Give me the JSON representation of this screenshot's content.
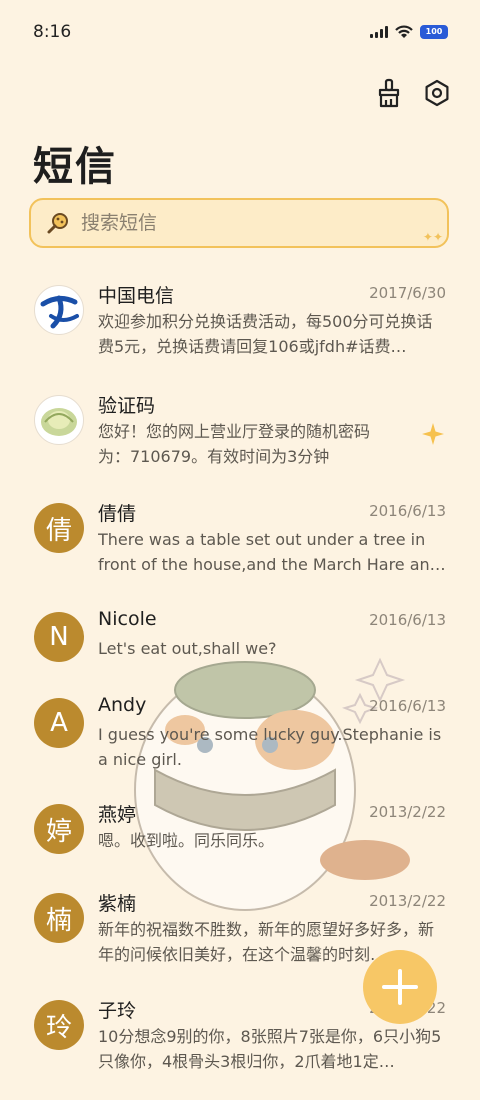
{
  "status": {
    "time": "8:16",
    "battery": "100"
  },
  "page": {
    "title": "短信"
  },
  "search": {
    "placeholder": "搜索短信"
  },
  "messages": [
    {
      "name": "中国电信",
      "date": "2017/6/30",
      "preview": "欢迎参加积分兑换话费活动，每500分可兑换话费5元，兑换话费请回复106或jfdh#话费…",
      "avatar": "china-telecom-logo"
    },
    {
      "name": "验证码",
      "date": "",
      "preview": "您好！您的网上营业厅登录的随机密码为：710679。有效时间为3分钟",
      "avatar": "cabbage-image",
      "starred": true
    },
    {
      "name": "倩倩",
      "date": "2016/6/13",
      "preview": "There was a table set out under a tree in front of the house,and the March Hare an…",
      "avatar_text": "倩"
    },
    {
      "name": "Nicole",
      "date": "2016/6/13",
      "preview": "Let's eat out,shall we?",
      "avatar_text": "N"
    },
    {
      "name": "Andy",
      "date": "2016/6/13",
      "preview": "I guess you're some lucky guy.Stephanie is a nice girl.",
      "avatar_text": "A"
    },
    {
      "name": "燕婷",
      "date": "2013/2/22",
      "preview": "嗯。收到啦。同乐同乐。",
      "avatar_text": "婷"
    },
    {
      "name": "紫楠",
      "date": "2013/2/22",
      "preview": "新年的祝福数不胜数，新年的愿望好多好多，新年的问候依旧美好，在这个温馨的时刻…",
      "avatar_text": "楠"
    },
    {
      "name": "子玲",
      "date": "2013/2/22",
      "preview": "10分想念9别的你，8张照片7张是你，6只小狗5只像你，4根骨头3根归你，2爪着地1定…",
      "avatar_text": "玲"
    }
  ],
  "colors": {
    "background": "#fdf3e2",
    "accent": "#f7c766",
    "avatar": "#bb8a2e"
  }
}
